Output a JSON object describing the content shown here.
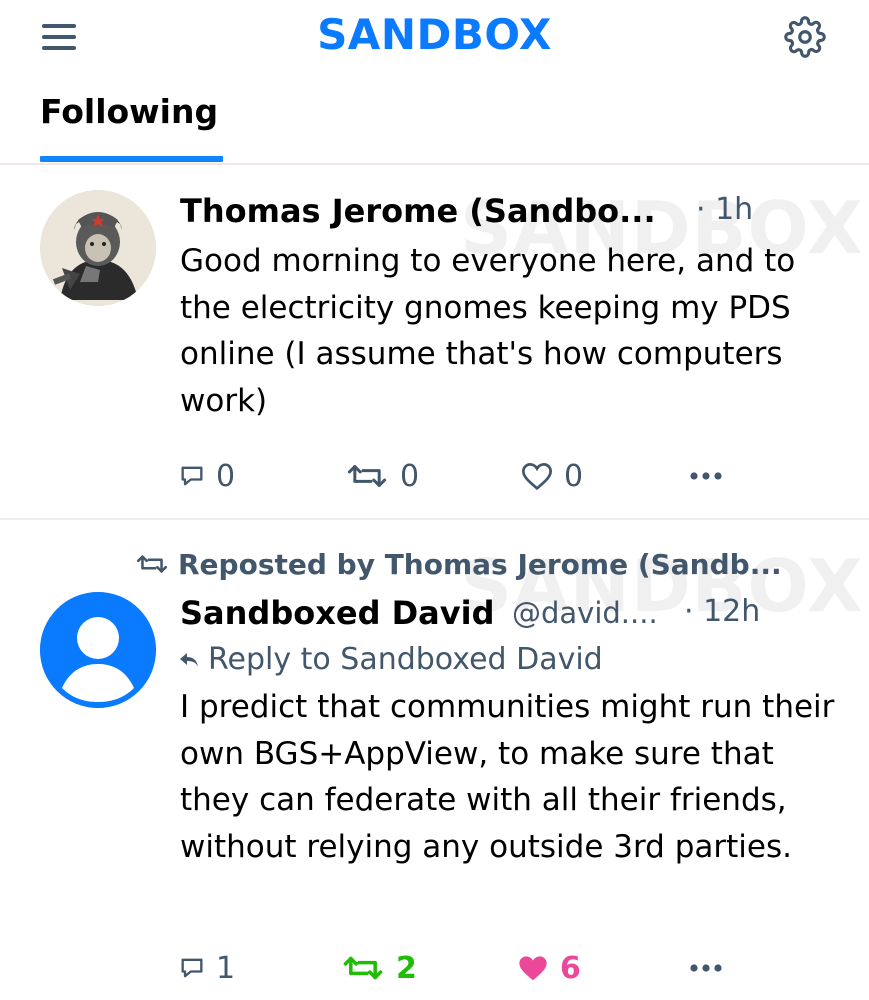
{
  "app": {
    "brand": "SANDBOX",
    "brand_color": "#0a7aff"
  },
  "header": {
    "menu_icon": "hamburger-menu-icon",
    "settings_icon": "gear-icon"
  },
  "tabs": [
    {
      "label": "Following",
      "active": true
    }
  ],
  "posts": [
    {
      "author": "Thomas Jerome (Sandbo...",
      "time": "· 1h",
      "watermark": "SANDBOX",
      "text": "Good morning to everyone here, and to the electricity gnomes keeping my PDS online (I assume that's how computers work)",
      "replies": "0",
      "reposts": "0",
      "likes": "0"
    },
    {
      "repost_label": "Reposted by Thomas Jerome (Sandb...",
      "author": "Sandboxed David",
      "handle": "@david....",
      "time": "· 12h",
      "watermark": "SANDBOX",
      "reply_to": "Reply to Sandboxed David",
      "text": "I predict that communities might run their own BGS+AppView, to make sure that they can federate with all their friends, without relying any outside 3rd parties.",
      "replies": "1",
      "reposts": "2",
      "likes": "6",
      "repost_color": "#20bc07",
      "like_color": "#ec4899"
    }
  ]
}
